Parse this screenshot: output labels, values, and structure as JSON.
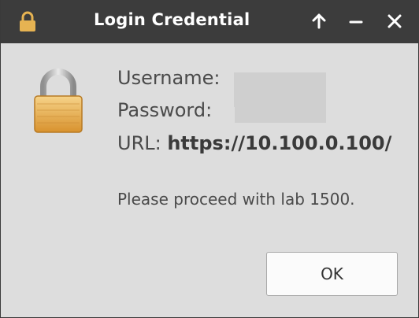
{
  "window": {
    "title": "Login Credential",
    "title_icon": "lock-icon",
    "buttons": [
      "arrow-up-icon",
      "minimize-icon",
      "close-icon"
    ]
  },
  "dialog": {
    "icon": "padlock-icon",
    "username_label": "Username:",
    "username_value": "",
    "password_label": "Password:",
    "password_value": "",
    "url_label": "URL:",
    "url_value": "https://10.100.0.100/",
    "message": "Please proceed with lab 1500.",
    "ok_label": "OK"
  },
  "colors": {
    "titlebar": "#3c3c3c",
    "background": "#dddddd",
    "text": "#4a4a4a",
    "lock_gold": "#e8a94a"
  }
}
